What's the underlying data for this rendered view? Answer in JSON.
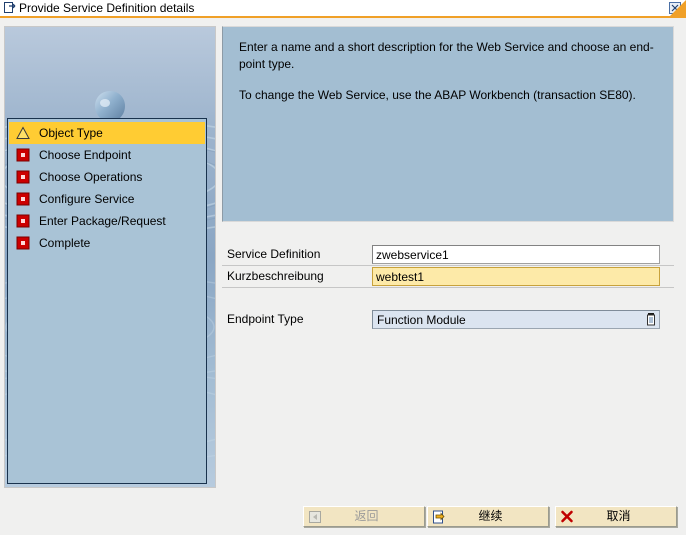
{
  "window": {
    "title": "Provide Service Definition details",
    "title_icon": "window-document-icon",
    "close_icon": "close-icon",
    "accent_color": "#f0a028"
  },
  "sidebar": {
    "illustration": "water-ripple-droplet-image",
    "steps": [
      {
        "label": "Object Type",
        "icon": "warning-triangle-icon",
        "state": "active"
      },
      {
        "label": "Choose Endpoint",
        "icon": "red-square-icon",
        "state": "pending"
      },
      {
        "label": "Choose Operations",
        "icon": "red-square-icon",
        "state": "pending"
      },
      {
        "label": "Configure Service",
        "icon": "red-square-icon",
        "state": "pending"
      },
      {
        "label": "Enter Package/Request",
        "icon": "red-square-icon",
        "state": "pending"
      },
      {
        "label": "Complete",
        "icon": "red-square-icon",
        "state": "pending"
      }
    ],
    "active_color": "#ffcc33",
    "panel_color": "#a9c3d6"
  },
  "info": {
    "paragraph1": "Enter a name and a short description for the Web Service and choose an end-point type.",
    "paragraph2": "To change the Web Service, use the ABAP Workbench (transaction SE80).",
    "background_color": "#a3bed2"
  },
  "form": {
    "service_definition": {
      "label": "Service Definition",
      "value": "zwebservice1",
      "placeholder": ""
    },
    "short_description": {
      "label": "Kurzbeschreibung",
      "value": "webtest1",
      "placeholder": "",
      "highlight_color": "#fdeaa8"
    },
    "endpoint_type": {
      "label": "Endpoint Type",
      "value": "Function Module",
      "dropdown_icon": "value-help-list-icon"
    }
  },
  "buttons": {
    "back": {
      "label": "返回",
      "icon": "back-arrow-icon",
      "enabled": false
    },
    "continue": {
      "label": "继续",
      "icon": "continue-arrow-icon",
      "enabled": true
    },
    "cancel": {
      "label": "取消",
      "icon": "red-x-icon",
      "enabled": true
    }
  }
}
